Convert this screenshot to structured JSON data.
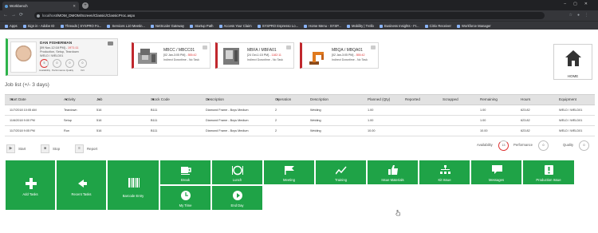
{
  "browser": {
    "tab_title": "Workbench",
    "url_host": "localhost",
    "url_path": "/MOM_DMOM/Screen/Classic/ClassicProc.aspx",
    "bookmarks": [
      "Apps",
      "Sign in - Adobe ID",
      "Threads | SYSPRO Fo...",
      "Services L10 Meetin...",
      "NetScaler Gateway",
      "Startup Path",
      "Access Your Claim",
      "SYSPRO Espresso Lo...",
      "Home Menu - SYSP...",
      "Mobility | Trello",
      "Business Insights - Fr...",
      "Citrix Receiver",
      "Workforce Manager"
    ]
  },
  "user": {
    "name": "DAN FISHERMAN",
    "shift_prefix": "[09 Nov-12:18 PM] -",
    "shift_value": "1971:11",
    "role_line1": "Production, Setup, Teardown",
    "role_line2": "WELD / WELD01",
    "kpis": [
      {
        "label": "Availability",
        "value": "5"
      },
      {
        "label": "Performance",
        "value": "0"
      },
      {
        "label": "Quality",
        "value": "0"
      },
      {
        "label": "Oct",
        "value": "0"
      }
    ]
  },
  "machines": [
    {
      "code": "MBCC / MBCC01",
      "time_prefix": "[02 Jan-3:05 PM] -",
      "time_value": "555:42",
      "status": "Indirect Downtime - No Task"
    },
    {
      "code": "MBFA / MBFA01",
      "time_prefix": "[24 Oct-1:15 PM] -",
      "time_value": "1182:11",
      "status": "Indirect Downtime - No Task"
    },
    {
      "code": "MBQA / MBQA01",
      "time_prefix": "[02 Jan-3:05 PM] -",
      "time_value": "555:42",
      "status": "Indirect Downtime - No Task"
    }
  ],
  "home": {
    "label": "HOME"
  },
  "job_list": {
    "title": "Job list (+/- 3 days)",
    "columns": [
      "Start Date",
      "Activity",
      "Job",
      "Stock Code",
      "Description",
      "Operation",
      "Description",
      "Planned (Qty)",
      "Reported",
      "Scrapped",
      "Remaining",
      "Hours",
      "Equipment"
    ],
    "rows": [
      [
        "11/7/2018 10:05 AM",
        "Teardown",
        "516",
        "B111",
        "Diamond Frame - Boys Medium",
        "2",
        "Welding",
        "1.00",
        "",
        "",
        "1.00",
        "623.82",
        "WELD / WELD01"
      ],
      [
        "11/6/2018 9:00 PM",
        "Setup",
        "516",
        "B111",
        "Diamond Frame - Boys Medium",
        "2",
        "Welding",
        "1.00",
        "",
        "",
        "1.00",
        "623.82",
        "WELD / WELD01"
      ],
      [
        "11/7/2018 9:05 PM",
        "Run",
        "516",
        "B111",
        "Diamond Frame - Boys Medium",
        "2",
        "Welding",
        "10.00",
        "",
        "",
        "10.00",
        "623.82",
        "WELD / WELD01"
      ]
    ]
  },
  "actions": {
    "start": "Start",
    "stop": "Stop",
    "report": "Report"
  },
  "kpi_bottom": [
    {
      "label": "Availability",
      "value": "13"
    },
    {
      "label": "Performance",
      "value": "0"
    },
    {
      "label": "Quality",
      "value": "0"
    }
  ],
  "tiles": {
    "add_tasks": "Add Tasks",
    "recent_tasks": "Recent Tasks",
    "barcode_entry": "Barcode Entry",
    "break": "Break",
    "lunch": "Lunch",
    "meeting": "Meeting",
    "training": "Training",
    "issue_materials": "Issue Materials",
    "kit_issue": "Kit Issue",
    "messages": "Messages",
    "production_issue": "Production Issue",
    "my_time": "My Time",
    "end_day": "End Day"
  },
  "colors": {
    "tile_green": "#1fa347",
    "accent_red": "#c0272d",
    "active_green": "#2db34a"
  }
}
